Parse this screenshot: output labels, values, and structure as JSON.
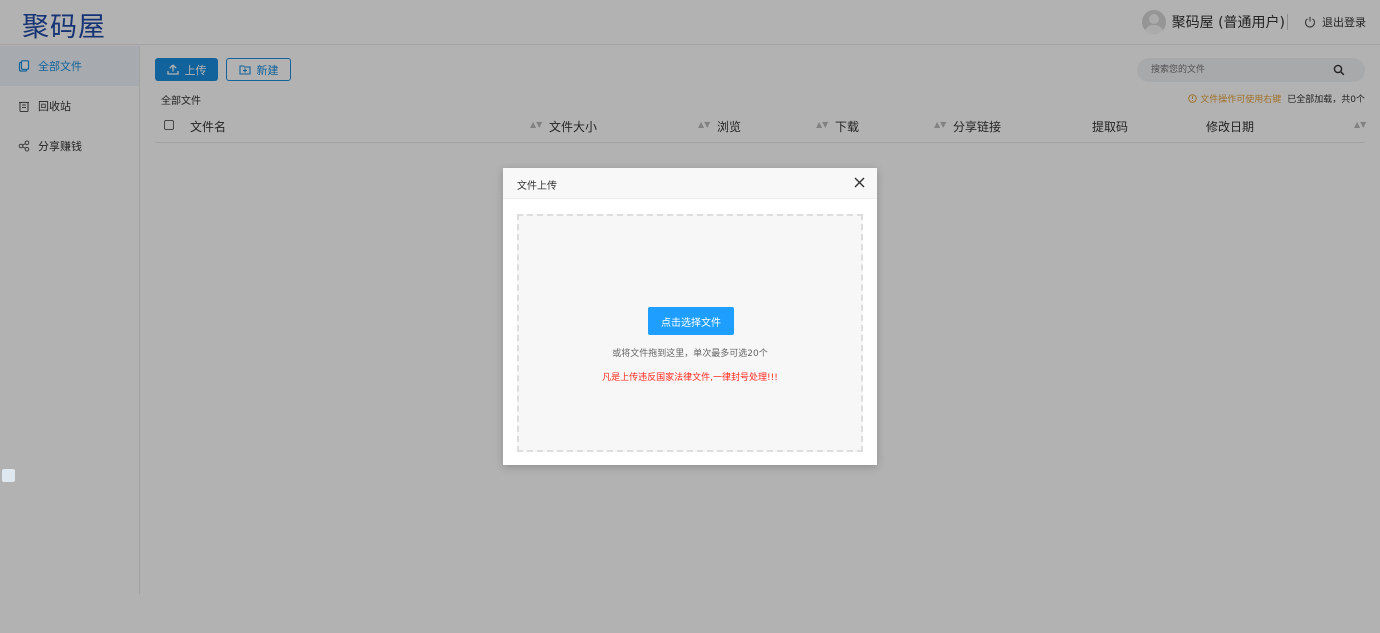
{
  "header": {
    "logo": "聚码屋",
    "username": "聚码屋 (普通用户)",
    "logout": "退出登录"
  },
  "sidebar": {
    "items": [
      {
        "label": "全部文件",
        "icon": "files-icon",
        "active": true
      },
      {
        "label": "回收站",
        "icon": "trash-icon",
        "active": false
      },
      {
        "label": "分享赚钱",
        "icon": "share-icon",
        "active": false
      }
    ]
  },
  "toolbar": {
    "upload_label": "上传",
    "new_label": "新建",
    "search_placeholder": "搜索您的文件"
  },
  "breadcrumb": "全部文件",
  "tip": {
    "warn": "文件操作可使用右键",
    "count": "已全部加载，共0个"
  },
  "table": {
    "columns": [
      "文件名",
      "文件大小",
      "浏览",
      "下载",
      "分享链接",
      "提取码",
      "修改日期"
    ]
  },
  "modal": {
    "title": "文件上传",
    "pick_button": "点击选择文件",
    "hint": "或将文件拖到这里，单次最多可选20个",
    "warning": "凡是上传违反国家法律文件,一律封号处理!!!"
  },
  "colors": {
    "accent": "#1b8fe0",
    "pick_button": "#1e9fff",
    "warning": "#ff2a1f",
    "tip": "#e6a23c"
  }
}
